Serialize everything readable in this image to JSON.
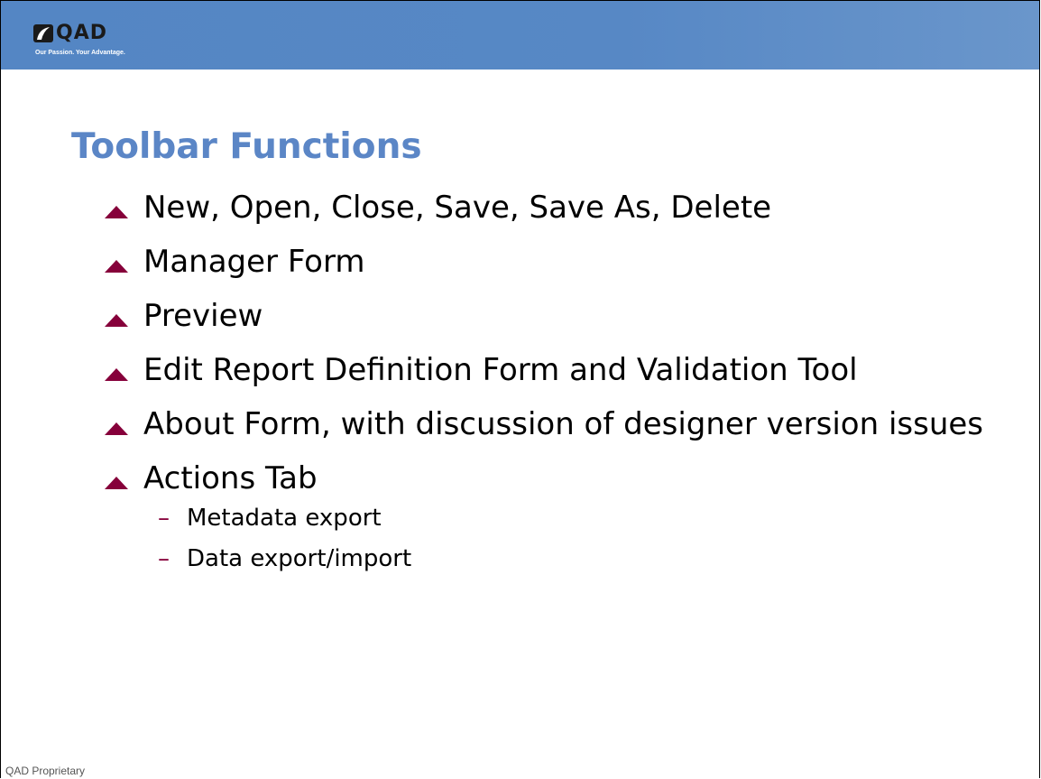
{
  "header": {
    "logo_text": "QAD",
    "tagline": "Our Passion. Your Advantage.",
    "bg_color": "#5788c5"
  },
  "slide": {
    "title": "Toolbar Functions",
    "bullets": [
      {
        "text": "New, Open, Close, Save, Save As, Delete"
      },
      {
        "text": "Manager Form"
      },
      {
        "text": "Preview"
      },
      {
        "text": "Edit Report Definition Form and Validation Tool"
      },
      {
        "text": "About Form, with discussion of designer version issues"
      },
      {
        "text": "Actions Tab",
        "sub": [
          "Metadata export",
          "Data export/import"
        ]
      }
    ],
    "marker_color": "#86003a",
    "title_color": "#5b86c6"
  },
  "footer": {
    "text": "QAD Proprietary"
  }
}
